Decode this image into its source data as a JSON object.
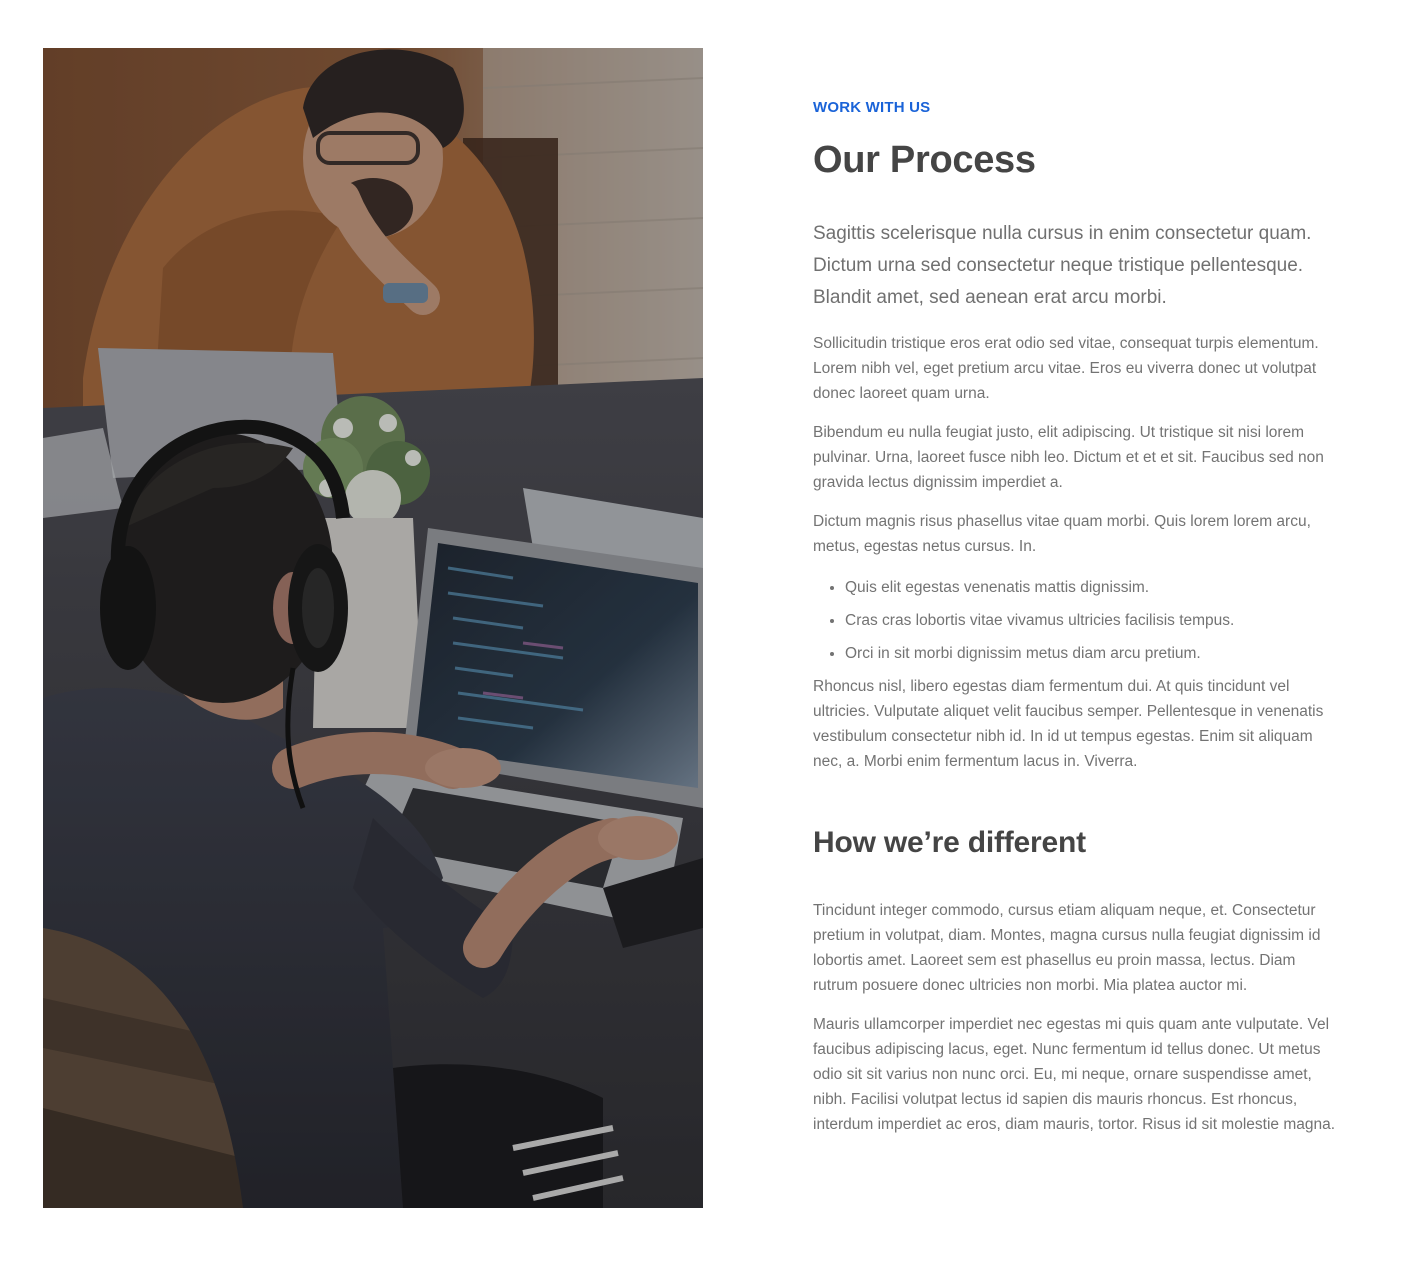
{
  "image": {
    "alt": "",
    "icon": "photo-people-working-on-laptops"
  },
  "section": {
    "eyebrow": "WORK WITH US",
    "title": "Our Process",
    "lead": "Sagittis scelerisque nulla cursus in enim consectetur quam. Dictum urna sed consectetur neque tristique pellentesque. Blandit amet, sed aenean erat arcu morbi.",
    "paragraphs": [
      "Sollicitudin tristique eros erat odio sed vitae, consequat turpis elementum. Lorem nibh vel, eget pretium arcu vitae. Eros eu viverra donec ut volutpat donec laoreet quam urna.",
      "Bibendum eu nulla feugiat justo, elit adipiscing. Ut tristique sit nisi lorem pulvinar. Urna, laoreet fusce nibh leo. Dictum et et et sit. Faucibus sed non gravida lectus dignissim imperdiet a.",
      "Dictum magnis risus phasellus vitae quam morbi. Quis lorem lorem arcu, metus, egestas netus cursus. In."
    ],
    "bullets": [
      "Quis elit egestas venenatis mattis dignissim.",
      "Cras cras lobortis vitae vivamus ultricies facilisis tempus.",
      "Orci in sit morbi dignissim metus diam arcu pretium."
    ],
    "closing": "Rhoncus nisl, libero egestas diam fermentum dui. At quis tincidunt vel ultricies. Vulputate aliquet velit faucibus semper. Pellentesque in venenatis vestibulum consectetur nibh id. In id ut tempus egestas. Enim sit aliquam nec, a. Morbi enim fermentum lacus in. Viverra."
  },
  "different": {
    "title": "How we’re different",
    "paragraphs": [
      "Tincidunt integer commodo, cursus etiam aliquam neque, et. Consectetur pretium in volutpat, diam. Montes, magna cursus nulla feugiat dignissim id lobortis amet. Laoreet sem est phasellus eu proin massa, lectus. Diam rutrum posuere donec ultricies non morbi. Mia platea auctor mi.",
      "Mauris ullamcorper imperdiet nec egestas mi quis quam ante vulputate. Vel faucibus adipiscing lacus, eget. Nunc fermentum id tellus donec. Ut metus odio sit sit varius non nunc orci. Eu, mi neque, ornare suspendisse amet, nibh. Facilisi volutpat lectus id sapien dis mauris rhoncus. Est rhoncus, interdum imperdiet ac eros, diam mauris, tortor. Risus id sit molestie magna."
    ]
  },
  "colors": {
    "accent": "#1a63d8",
    "heading": "#454545",
    "body": "#737373"
  }
}
